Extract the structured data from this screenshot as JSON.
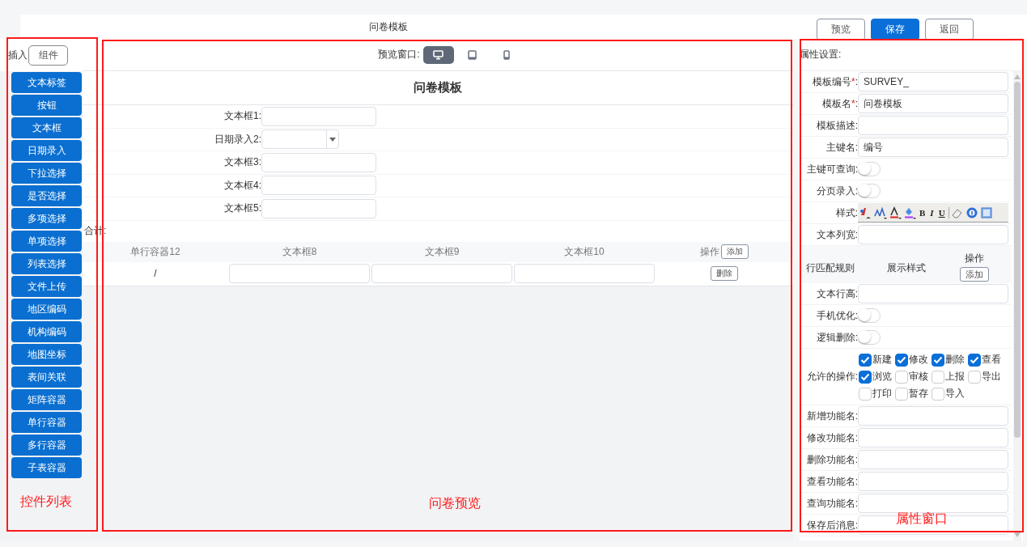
{
  "header": {
    "title": "问卷模板",
    "buttons": [
      {
        "label": "预览",
        "primary": false
      },
      {
        "label": "保存",
        "primary": true
      },
      {
        "label": "返回",
        "primary": false
      }
    ]
  },
  "palette": {
    "insert_label": "插入",
    "tab": "组件",
    "items": [
      "文本标签",
      "按钮",
      "文本框",
      "日期录入",
      "下拉选择",
      "是否选择",
      "多项选择",
      "单项选择",
      "列表选择",
      "文件上传",
      "地区编码",
      "机构编码",
      "地图坐标",
      "表间关联",
      "矩阵容器",
      "单行容器",
      "多行容器",
      "子表容器"
    ]
  },
  "preview": {
    "device_label": "预览窗口:",
    "devices": [
      {
        "kind": "desktop",
        "selected": true
      },
      {
        "kind": "tablet",
        "selected": false
      },
      {
        "kind": "phone",
        "selected": false
      }
    ],
    "form_title": "问卷模板",
    "fields": [
      {
        "label": "文本框1:",
        "kind": "text"
      },
      {
        "label": "日期录入2:",
        "kind": "date"
      },
      {
        "label": "文本框3:",
        "kind": "text"
      },
      {
        "label": "文本框4:",
        "kind": "text"
      },
      {
        "label": "文本框5:",
        "kind": "text"
      }
    ],
    "total_label": "合计:",
    "table": {
      "columns": [
        "单行容器12",
        "文本框8",
        "文本框9",
        "文本框10",
        "操作"
      ],
      "add_button": "添加",
      "rows": [
        {
          "cells": [
            {
              "kind": "text",
              "value": "/"
            },
            {
              "kind": "input"
            },
            {
              "kind": "input"
            },
            {
              "kind": "input"
            },
            {
              "kind": "button",
              "label": "删除"
            }
          ]
        }
      ]
    }
  },
  "properties": {
    "title": "属性设置:",
    "items": [
      {
        "kind": "field",
        "label": "模板编号",
        "required_mark": "*",
        "label_end": ":",
        "value": "SURVEY_"
      },
      {
        "kind": "field",
        "label": "模板名",
        "required_mark": "*",
        "label_end": ":",
        "value": "问卷模板"
      },
      {
        "kind": "field",
        "label": "模板描述:"
      },
      {
        "kind": "field",
        "label": "主键名:",
        "value": "编号"
      },
      {
        "kind": "toggle",
        "label": "主键可查询:",
        "on": false
      },
      {
        "kind": "toggle",
        "label": "分页录入:",
        "on": false
      },
      {
        "kind": "toolbar",
        "label": "样式:",
        "text_tools": [
          "B",
          "I",
          "U"
        ]
      },
      {
        "kind": "field",
        "label": "文本列宽:"
      },
      {
        "kind": "rules",
        "columns": [
          "行匹配规则",
          "展示样式",
          "操作"
        ],
        "add_button": "添加"
      },
      {
        "kind": "field",
        "label": "文本行高:"
      },
      {
        "kind": "toggle",
        "label": "手机优化:",
        "on": false
      },
      {
        "kind": "toggle",
        "label": "逻辑删除:",
        "on": false
      },
      {
        "kind": "checks",
        "label": "允许的操作:",
        "options": [
          {
            "label": "新建",
            "checked": true
          },
          {
            "label": "修改",
            "checked": true
          },
          {
            "label": "删除",
            "checked": true
          },
          {
            "label": "查看",
            "checked": true
          },
          {
            "label": "浏览",
            "checked": true
          },
          {
            "label": "审核",
            "checked": false
          },
          {
            "label": "上报",
            "checked": false
          },
          {
            "label": "导出",
            "checked": false
          },
          {
            "label": "打印",
            "checked": false
          },
          {
            "label": "暂存",
            "checked": false
          },
          {
            "label": "导入",
            "checked": false
          }
        ]
      },
      {
        "kind": "field",
        "label": "新增功能名:"
      },
      {
        "kind": "field",
        "label": "修改功能名:"
      },
      {
        "kind": "field",
        "label": "删除功能名:"
      },
      {
        "kind": "field",
        "label": "查看功能名:"
      },
      {
        "kind": "field",
        "label": "查询功能名:"
      },
      {
        "kind": "field",
        "label": "保存后消息:"
      }
    ]
  },
  "annotations": [
    {
      "label": "控件列表"
    },
    {
      "label": "问卷预览"
    },
    {
      "label": "属性窗口"
    }
  ]
}
